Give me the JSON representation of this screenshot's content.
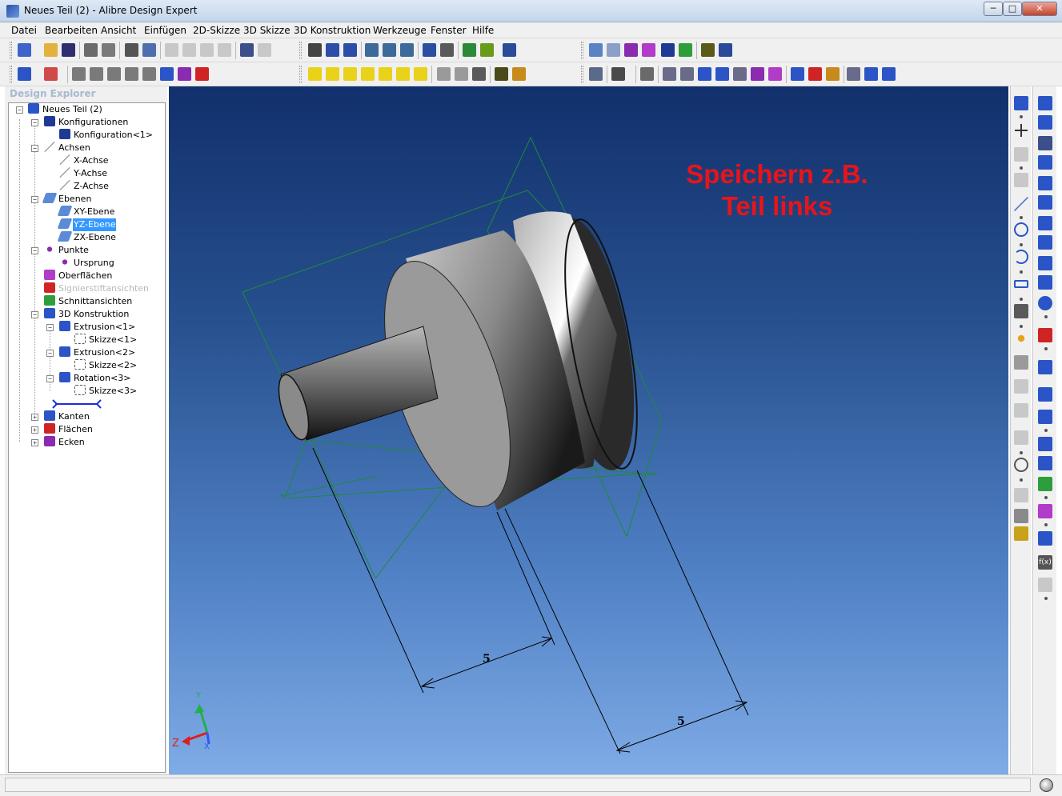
{
  "window": {
    "title": "Neues Teil (2) - Alibre Design Expert",
    "minimize_label": "─",
    "maximize_label": "□",
    "close_label": "✕"
  },
  "menu": {
    "items": [
      "Datei",
      "Bearbeiten",
      "Ansicht",
      "Einfügen",
      "2D-Skizze",
      "3D Skizze",
      "3D Konstruktion",
      "Werkzeuge",
      "Fenster",
      "Hilfe"
    ]
  },
  "explorer": {
    "title": "Design Explorer",
    "tree": [
      {
        "label": "Neues Teil (2)",
        "icon": "part-icon",
        "color": "#2b55c6"
      },
      {
        "label": "Konfigurationen",
        "icon": "configurations-icon",
        "color": "#1f3a94"
      },
      {
        "label": "Konfiguration<1>",
        "icon": "configuration-icon",
        "color": "#1f3a94"
      },
      {
        "label": "Achsen",
        "icon": "axes-icon",
        "color": "#666666"
      },
      {
        "label": "X-Achse",
        "icon": "axis-icon",
        "color": "#666666"
      },
      {
        "label": "Y-Achse",
        "icon": "axis-icon",
        "color": "#666666"
      },
      {
        "label": "Z-Achse",
        "icon": "axis-icon",
        "color": "#666666"
      },
      {
        "label": "Ebenen",
        "icon": "planes-icon",
        "color": "#5b8bd6"
      },
      {
        "label": "XY-Ebene",
        "icon": "plane-icon",
        "color": "#5b8bd6"
      },
      {
        "label": "YZ-Ebene",
        "icon": "plane-icon",
        "color": "#5b8bd6"
      },
      {
        "label": "ZX-Ebene",
        "icon": "plane-icon",
        "color": "#5b8bd6"
      },
      {
        "label": "Punkte",
        "icon": "points-icon",
        "color": "#8a2bb0"
      },
      {
        "label": "Ursprung",
        "icon": "origin-icon",
        "color": "#8a2bb0"
      },
      {
        "label": "Oberflächen",
        "icon": "surfaces-icon",
        "color": "#b03cc8"
      },
      {
        "label": "Signierstiftansichten",
        "icon": "markup-icon",
        "color": "#d02424"
      },
      {
        "label": "Schnittansichten",
        "icon": "section-icon",
        "color": "#2e9e3c"
      },
      {
        "label": "3D Konstruktion",
        "icon": "feature-icon",
        "color": "#2b55c6"
      },
      {
        "label": "Extrusion<1>",
        "icon": "extrude-icon",
        "color": "#2b55c6"
      },
      {
        "label": "Skizze<1>",
        "icon": "sketch-icon",
        "color": "#555555"
      },
      {
        "label": "Extrusion<2>",
        "icon": "extrude-icon",
        "color": "#2b55c6"
      },
      {
        "label": "Skizze<2>",
        "icon": "sketch-icon",
        "color": "#555555"
      },
      {
        "label": "Rotation<3>",
        "icon": "revolve-icon",
        "color": "#2b55c6"
      },
      {
        "label": "Skizze<3>",
        "icon": "sketch-icon",
        "color": "#555555"
      },
      {
        "label": "",
        "icon": "rollback-bar-icon",
        "color": "#1a2fd6"
      },
      {
        "label": "Kanten",
        "icon": "edges-icon",
        "color": "#2b55c6"
      },
      {
        "label": "Flächen",
        "icon": "faces-icon",
        "color": "#d02424"
      },
      {
        "label": "Ecken",
        "icon": "vertices-icon",
        "color": "#8a2bb0"
      }
    ],
    "selected": "YZ-Ebene",
    "disabled": "Signierstiftansichten"
  },
  "viewport": {
    "note_line1": "Speichern z.B.",
    "note_line2": "Teil links",
    "dimension_1": "5",
    "dimension_2": "5",
    "axis_labels": {
      "z": "Z",
      "y": "Y",
      "x": "X"
    }
  },
  "colors": {
    "note": "#e8141a",
    "selection": "#3399ff",
    "sketch_plane": "#1f8a3a"
  }
}
